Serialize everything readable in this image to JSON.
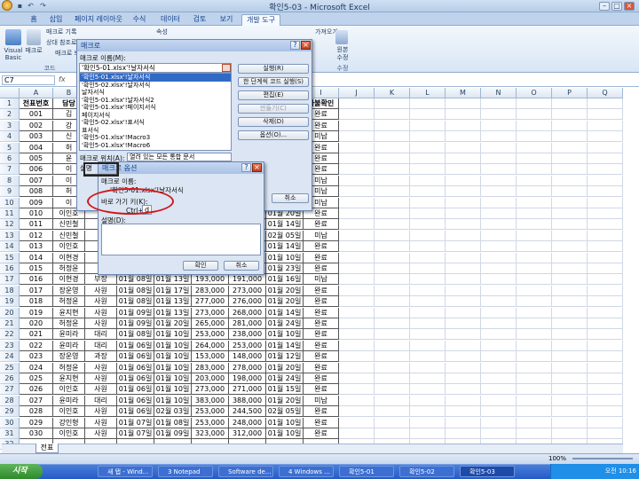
{
  "window": {
    "title": "확인5-03 - Microsoft Excel"
  },
  "ribbon": {
    "tabs": [
      "홈",
      "삽입",
      "페이지 레이아웃",
      "수식",
      "데이터",
      "검토",
      "보기",
      "개발 도구"
    ],
    "active_tab": "개발 도구",
    "visual_basic": "Visual Basic",
    "macro": "매크로",
    "record_macro": "매크로 기록",
    "relative_ref": "상대 참조로 기록",
    "macro_security": "매크로 보안",
    "group_code": "코드",
    "properties": "속성",
    "import": "가져오기",
    "source": "원본",
    "source_sub": "수정",
    "xml_group": "XML",
    "code_view": "코드 보기"
  },
  "namebox": "C7",
  "fx": "fx",
  "columns": [
    "A",
    "B",
    "C",
    "D",
    "E",
    "F",
    "G",
    "H",
    "I",
    "J",
    "K",
    "L",
    "M",
    "N",
    "O",
    "P",
    "Q"
  ],
  "row_numbers": [
    "1",
    "2",
    "3",
    "4",
    "5",
    "6",
    "7",
    "8",
    "9",
    "10",
    "11",
    "12",
    "13",
    "14",
    "15",
    "16",
    "17",
    "18",
    "19",
    "20",
    "21",
    "22",
    "23",
    "24",
    "25",
    "26",
    "27",
    "28",
    "29",
    "30",
    "31",
    "32"
  ],
  "headers": {
    "a": "전표번호",
    "b": "담당",
    "i": "자불확인"
  },
  "rows": [
    {
      "a": "001",
      "b": "김",
      "c": "",
      "d": "",
      "e": "",
      "f": "",
      "g": "",
      "h": "",
      "i": "완료"
    },
    {
      "a": "002",
      "b": "강",
      "c": "",
      "d": "",
      "e": "",
      "f": "",
      "g": "",
      "h": "",
      "i": "완료"
    },
    {
      "a": "003",
      "b": "신",
      "c": "",
      "d": "",
      "e": "",
      "f": "",
      "g": "",
      "h": "",
      "i": "미납"
    },
    {
      "a": "004",
      "b": "허",
      "c": "",
      "d": "",
      "e": "",
      "f": "",
      "g": "",
      "h": "",
      "i": "완료"
    },
    {
      "a": "005",
      "b": "윤",
      "c": "",
      "d": "",
      "e": "",
      "f": "",
      "g": "",
      "h": "",
      "i": "완료"
    },
    {
      "a": "006",
      "b": "이",
      "c": "",
      "d": "",
      "e": "",
      "f": "",
      "g": "",
      "h": "",
      "i": "완료"
    },
    {
      "a": "007",
      "b": "이",
      "c": "",
      "d": "",
      "e": "",
      "f": "",
      "g": "",
      "h": "",
      "i": "미납"
    },
    {
      "a": "008",
      "b": "허",
      "c": "",
      "d": "",
      "e": "",
      "f": "",
      "g": "",
      "h": "",
      "i": "미납"
    },
    {
      "a": "009",
      "b": "이",
      "c": "",
      "d": "",
      "e": "",
      "f": "",
      "g": "",
      "h": "",
      "i": "미납"
    },
    {
      "a": "010",
      "b": "이인호",
      "c": "",
      "d": "",
      "e": "",
      "f": "",
      "g": "",
      "h": "01월 20일",
      "i": "완료"
    },
    {
      "a": "011",
      "b": "신민철",
      "c": "",
      "d": "",
      "e": "",
      "f": "",
      "g": "",
      "h": "01월 14일",
      "i": "완료"
    },
    {
      "a": "012",
      "b": "신민철",
      "c": "",
      "d": "",
      "e": "",
      "f": "",
      "g": "",
      "h": "02월 05일",
      "i": "미납"
    },
    {
      "a": "013",
      "b": "이인호",
      "c": "",
      "d": "",
      "e": "",
      "f": "",
      "g": "",
      "h": "01월 14일",
      "i": "완료"
    },
    {
      "a": "014",
      "b": "이현경",
      "c": "",
      "d": "",
      "e": "",
      "f": "",
      "g": "",
      "h": "01월 10일",
      "i": "완료"
    },
    {
      "a": "015",
      "b": "허정윤",
      "c": "",
      "d": "",
      "e": "",
      "f": "",
      "g": "",
      "h": "01월 23일",
      "i": "완료"
    },
    {
      "a": "016",
      "b": "이현경",
      "c": "부장",
      "d": "01월 08일",
      "e": "01월 13일",
      "f": "193,000",
      "g": "191,000",
      "h": "01월 16일",
      "i": "미납"
    },
    {
      "a": "017",
      "b": "장운영",
      "c": "사원",
      "d": "01월 08일",
      "e": "01월 17일",
      "f": "283,000",
      "g": "273,000",
      "h": "01월 20일",
      "i": "완료"
    },
    {
      "a": "018",
      "b": "허정윤",
      "c": "사원",
      "d": "01월 08일",
      "e": "01월 13일",
      "f": "277,000",
      "g": "276,000",
      "h": "01월 20일",
      "i": "완료"
    },
    {
      "a": "019",
      "b": "윤지현",
      "c": "사원",
      "d": "01월 09일",
      "e": "01월 13일",
      "f": "273,000",
      "g": "268,000",
      "h": "01월 14일",
      "i": "완료"
    },
    {
      "a": "020",
      "b": "허정윤",
      "c": "사원",
      "d": "01월 09일",
      "e": "01월 20일",
      "f": "265,000",
      "g": "281,000",
      "h": "01월 24일",
      "i": "완료"
    },
    {
      "a": "021",
      "b": "윤미라",
      "c": "대리",
      "d": "01월 08일",
      "e": "01월 10일",
      "f": "253,000",
      "g": "238,000",
      "h": "01월 10일",
      "i": "완료"
    },
    {
      "a": "022",
      "b": "윤미라",
      "c": "대리",
      "d": "01월 06일",
      "e": "01월 10일",
      "f": "264,000",
      "g": "253,000",
      "h": "01월 14일",
      "i": "완료"
    },
    {
      "a": "023",
      "b": "장운영",
      "c": "과장",
      "d": "01월 06일",
      "e": "01월 10일",
      "f": "153,000",
      "g": "148,000",
      "h": "01월 12일",
      "i": "완료"
    },
    {
      "a": "024",
      "b": "허정윤",
      "c": "사원",
      "d": "01월 06일",
      "e": "01월 10일",
      "f": "283,000",
      "g": "278,000",
      "h": "01월 20일",
      "i": "완료"
    },
    {
      "a": "025",
      "b": "윤지현",
      "c": "사원",
      "d": "01월 06일",
      "e": "01월 10일",
      "f": "203,000",
      "g": "198,000",
      "h": "01월 24일",
      "i": "완료"
    },
    {
      "a": "026",
      "b": "이인호",
      "c": "사원",
      "d": "01월 06일",
      "e": "01월 10일",
      "f": "273,000",
      "g": "271,000",
      "h": "01월 15일",
      "i": "완료"
    },
    {
      "a": "027",
      "b": "윤미라",
      "c": "대리",
      "d": "01월 06일",
      "e": "01월 10일",
      "f": "383,000",
      "g": "388,000",
      "h": "01월 20일",
      "i": "미납"
    },
    {
      "a": "028",
      "b": "이인호",
      "c": "사원",
      "d": "01월 06일",
      "e": "02월 03일",
      "f": "253,000",
      "g": "244,500",
      "h": "02월 05일",
      "i": "완료"
    },
    {
      "a": "029",
      "b": "강인형",
      "c": "사원",
      "d": "01월 07일",
      "e": "01월 08일",
      "f": "253,000",
      "g": "248,000",
      "h": "01월 10일",
      "i": "완료"
    },
    {
      "a": "030",
      "b": "이인호",
      "c": "사원",
      "d": "01월 07일",
      "e": "01월 09일",
      "f": "323,000",
      "g": "312,000",
      "h": "01월 10일",
      "i": "완료"
    }
  ],
  "sheet_tab": "전표",
  "macro_dialog": {
    "title": "매크로",
    "name_label": "매크로 이름(M):",
    "name_value": "'확인5-01.xlsx'!날자서식",
    "list": [
      "'확인5-01.xlsx'!날자서식",
      "'확인5-02.xlsx'!날자서식",
      "날자서식",
      "'확인5-01.xlsx'!날자서식2",
      "'확인5-01.xlsx'!페이지서식",
      "페이지서식",
      "'확인5-02.xlsx'!표서식",
      "표서식",
      "'확인5-01.xlsx'!Macro3",
      "'확인5-01.xlsx'!Macro6"
    ],
    "run": "실행(R)",
    "step": "한 단계씩 코드 실행(S)",
    "edit": "편집(E)",
    "create": "만들기(C)",
    "delete": "삭제(D)",
    "options": "옵션(O)...",
    "cancel": "취소",
    "location_label": "매크로 위치(A):",
    "location_value": "열려 있는 모든 통합 문서",
    "desc_label": "설명"
  },
  "options_dialog": {
    "title": "매크로 옵션",
    "name_label": "매크로 이름:",
    "name_value": "'확인5-01.xlsx'!날자서식",
    "shortcut_label": "바로 가기 키(K):",
    "ctrl": "Ctrl+",
    "key": "d",
    "desc_label": "설명(D):",
    "ok": "확인",
    "cancel": "취소"
  },
  "status": {
    "zoom": "100%"
  },
  "taskbar": {
    "start": "시작",
    "items": [
      "새 탭 - Wind...",
      "3 Notepad",
      "Software de...",
      "4 Windows ...",
      "확인5-01",
      "확인5-02",
      "확인5-03"
    ],
    "clock": "오전 10:16"
  }
}
